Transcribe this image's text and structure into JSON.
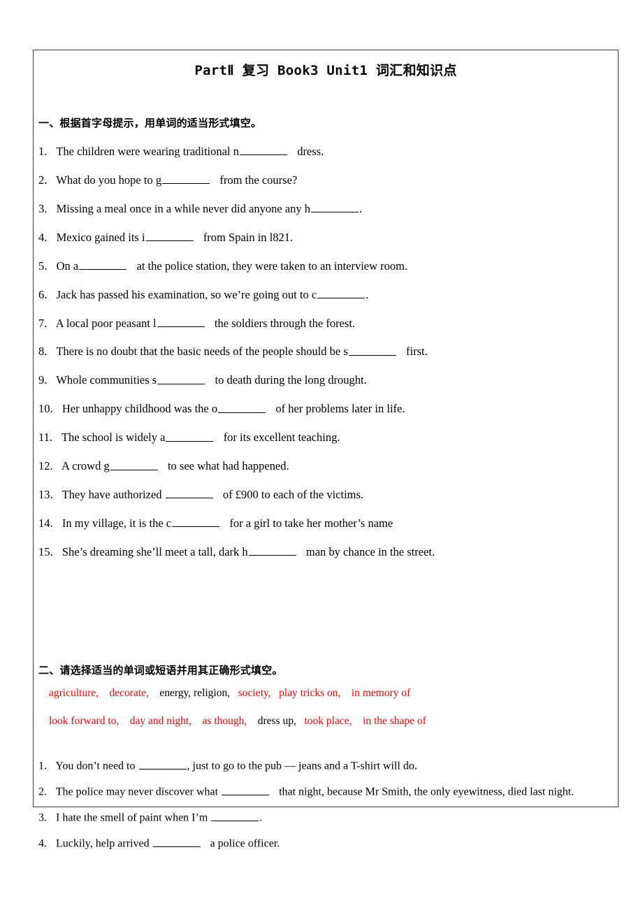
{
  "document": {
    "title": "PartⅡ 复习 Book3 Unit1 词汇和知识点",
    "accent_red": "#ff0000",
    "text_color": "#000000",
    "border_color": "#3a3a3a"
  },
  "section1": {
    "heading": "一、根据首字母提示，用单词的适当形式填空。",
    "questions": [
      {
        "num": "1.",
        "before": "The children were wearing traditional n",
        "after": "dress."
      },
      {
        "num": "2.",
        "before": "What do you hope to g",
        "after": "from the course?"
      },
      {
        "num": "3.",
        "before": "Missing a meal once in a while never did anyone any h",
        "after": "."
      },
      {
        "num": "4.",
        "before": "Mexico gained its i",
        "after": "from Spain in l821."
      },
      {
        "num": "5.",
        "before": "On a",
        "after": "at the police station, they were taken to an interview room."
      },
      {
        "num": "6.",
        "before": "Jack has passed his examination, so we’re going out to c",
        "after": "."
      },
      {
        "num": "7.",
        "before": "A local poor peasant l",
        "after": "the soldiers through the forest."
      },
      {
        "num": "8.",
        "before": "There is no doubt that the basic needs of the people should be s",
        "after": "first."
      },
      {
        "num": "9.",
        "before": "Whole communities s",
        "after": "to death during the long drought."
      },
      {
        "num": "10.",
        "before": "Her unhappy childhood was the o",
        "after": "of her problems later in life."
      },
      {
        "num": "11.",
        "before": "The school is widely a",
        "after": "for its excellent teaching."
      },
      {
        "num": "12.",
        "before": "A crowd g",
        "after": "to see what had happened."
      },
      {
        "num": "13.",
        "before": "They have authorized ",
        "after": "of £900 to each of the victims."
      },
      {
        "num": "14.",
        "before": "In my village, it is the c",
        "after": "for a girl to take her mother’s name"
      },
      {
        "num": "15.",
        "before": "She’s dreaming she’ll meet a tall, dark h",
        "after": "man by chance in the street."
      }
    ]
  },
  "section2": {
    "heading": "二、请选择适当的单词或短语并用其正确形式填空。",
    "wordbank_line1": [
      {
        "text": "agriculture,",
        "color": "red"
      },
      {
        "text": "decorate,",
        "color": "red"
      },
      {
        "text": "energy, religion,",
        "color": "black"
      },
      {
        "text": "society,",
        "color": "red"
      },
      {
        "text": "play tricks on,",
        "color": "red"
      },
      {
        "text": "in memory of",
        "color": "red"
      }
    ],
    "wordbank_line2": [
      {
        "text": "look forward to,",
        "color": "red"
      },
      {
        "text": "day and night,",
        "color": "red"
      },
      {
        "text": "as though,",
        "color": "red"
      },
      {
        "text": "dress up,",
        "color": "black"
      },
      {
        "text": "took place,",
        "color": "red"
      },
      {
        "text": "in the shape of",
        "color": "red"
      }
    ],
    "questions": [
      {
        "num": "1.",
        "before": "You don’t need to ",
        "after": ", just to go to the pub — jeans and a T-shirt will do."
      },
      {
        "num": "2.",
        "before": "The police may never discover what ",
        "after": "that night, because Mr Smith, the only eyewitness, died last night."
      },
      {
        "num": "3.",
        "before": "I hate the smell of paint when I’m ",
        "after": "."
      },
      {
        "num": "4.",
        "before": "Luckily, help arrived ",
        "after": "a police officer."
      }
    ]
  }
}
